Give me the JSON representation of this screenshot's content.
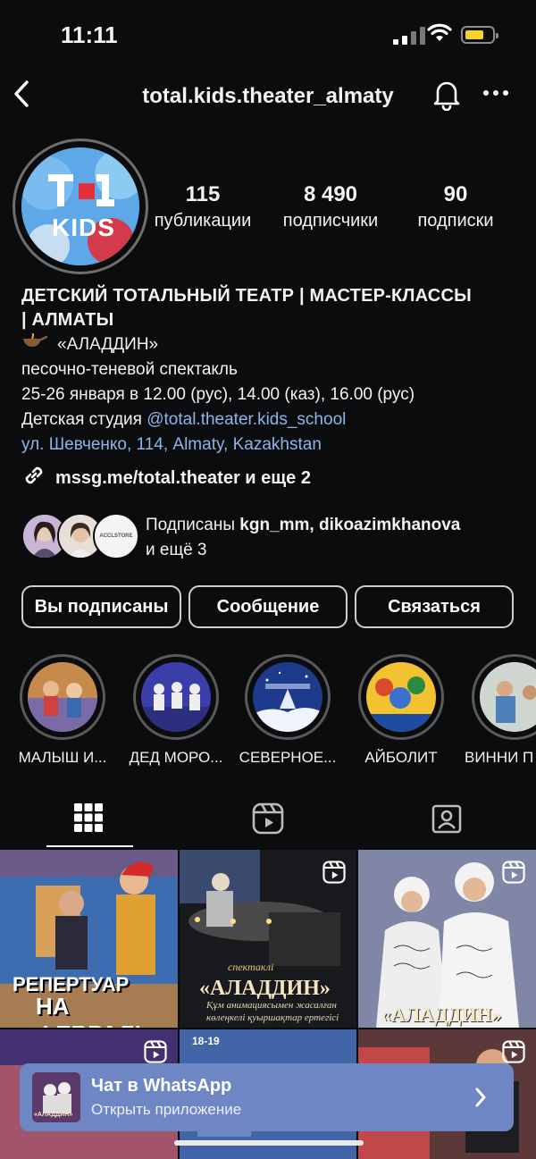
{
  "status_bar": {
    "time": "11:11"
  },
  "header": {
    "username": "total.kids.theater_almaty"
  },
  "avatar": {
    "logo_text": "KIDS"
  },
  "stats": [
    {
      "value": "115",
      "label": "публикации"
    },
    {
      "value": "8 490",
      "label": "подписчики"
    },
    {
      "value": "90",
      "label": "подписки"
    }
  ],
  "bio": {
    "name_line1": "ДЕТСКИЙ ТОТАЛЬНЫЙ ТЕАТР | МАСТЕР-КЛАССЫ",
    "name_line2": "| АЛМАТЫ",
    "line1": "«АЛАДДИН»",
    "line2": "песочно-теневой спектакль",
    "line3": "25-26 января в 12.00 (рус), 14.00 (каз), 16.00 (рус)",
    "line4_prefix": "Детская студия ",
    "line4_mention": "@total.theater.kids_school",
    "location": "ул. Шевченко, 114, Almaty, Kazakhstan"
  },
  "link": {
    "text": "mssg.me/total.theater и еще 2"
  },
  "followed_by": {
    "prefix": "Подписаны ",
    "names": "kgn_mm, dikoazimkhanova",
    "suffix": "и ещё 3",
    "avatar3_text": "ACCLSTORE"
  },
  "buttons": {
    "following": "Вы подписаны",
    "message": "Сообщение",
    "contact": "Связаться"
  },
  "highlights": [
    {
      "label": "МАЛЫШ И..."
    },
    {
      "label": "ДЕД МОРО..."
    },
    {
      "label": "СЕВЕРНОЕ..."
    },
    {
      "label": "АЙБОЛИТ"
    },
    {
      "label": "ВИННИ П"
    }
  ],
  "posts": {
    "p1_line1": "РЕПЕРТУАР",
    "p1_line2": "НА ФЕВРАЛЬ",
    "p2_small": "спектаклі",
    "p2_title": "«АЛАДДИН»",
    "p2_sub1": "Құм анимациясымен жасалған",
    "p2_sub2": "көлеңкелі қуыршақтар ертегісі",
    "p3_title": "«АЛАДДИН»",
    "p5_date": "18-19"
  },
  "banner": {
    "thumb_text": "«АЛАДДИН»",
    "title": "Чат в WhatsApp",
    "subtitle": "Открыть приложение"
  },
  "colors": {
    "background": "#0b0c0e",
    "mention": "#8cb6e8",
    "banner": "#6f86c4",
    "battery": "#f5d22c"
  }
}
